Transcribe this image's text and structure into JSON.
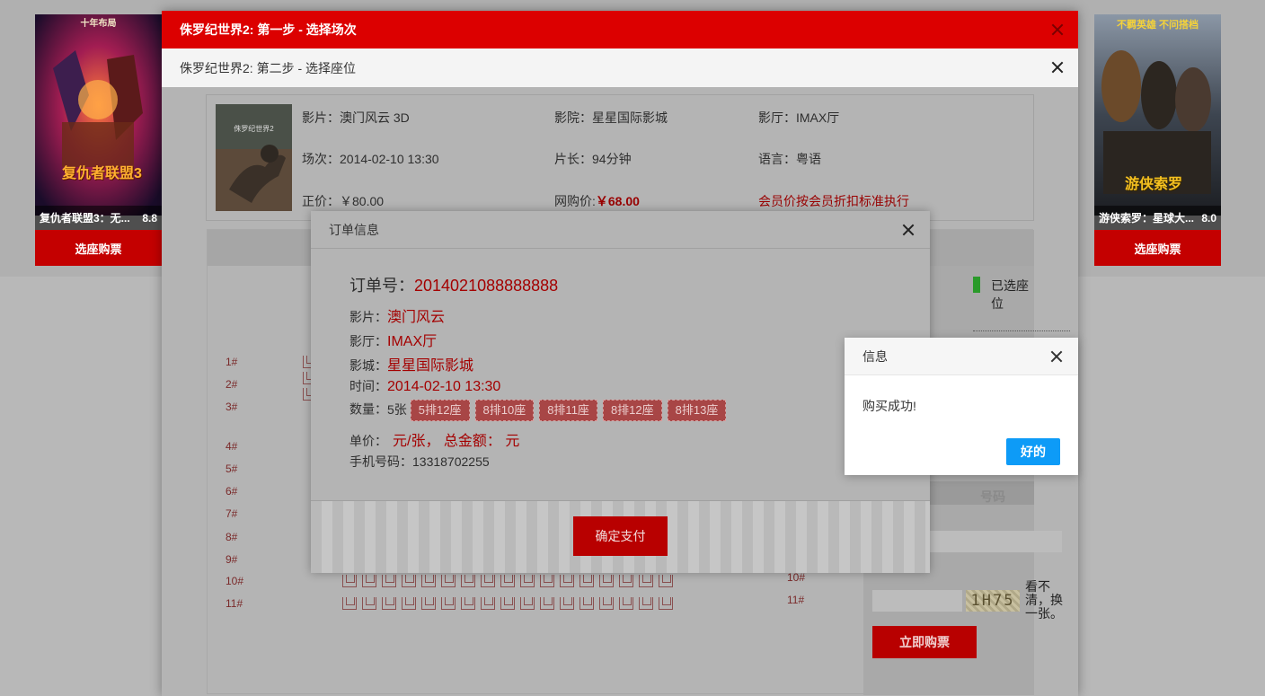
{
  "posters": {
    "left": {
      "title": "复仇者联盟3：无...",
      "rating": "8.8",
      "button": "选座购票",
      "art_text": "复仇者联盟3",
      "top_banner": "十年布局"
    },
    "right": {
      "title": "游侠索罗：星球大...",
      "rating": "8.0",
      "button": "选座购票",
      "art_text": "游侠索罗",
      "top_banner": "不羁英雄  不问搭档"
    }
  },
  "window": {
    "step1_title": "侏罗纪世界2: 第一步 - 选择场次",
    "step2_title": "侏罗纪世界2: 第二步 - 选择座位"
  },
  "movie_info": {
    "film_label": "影片：",
    "film": "澳门风云 3D",
    "cinema_label": "影院：",
    "cinema": "星星国际影城",
    "hall_label": "影厅：",
    "hall": "IMAX厅",
    "session_label": "场次：",
    "session": "2014-02-10 13:30",
    "length_label": "片长：",
    "length": "94分钟",
    "lang_label": "语言：",
    "lang": "粤语",
    "price_label": "正价：",
    "price": "￥80.00",
    "online_label": "网购价:",
    "online": "￥68.00",
    "member_note": "会员价按会员折扣标准执行",
    "poster_text": "侏罗纪世界2"
  },
  "seat_map": {
    "legend_selected": "已选座位",
    "rows_left": [
      "1#",
      "2#",
      "3#",
      "4#",
      "5#",
      "6#",
      "7#",
      "8#",
      "9#",
      "10#",
      "11#"
    ],
    "rows_right": [
      "10#",
      "11#"
    ],
    "phone_label_partial": "号码",
    "captcha": "1H75",
    "captcha_refresh": "看不清，换一张。",
    "buy_button": "立即购票"
  },
  "order_modal": {
    "title": "订单信息",
    "order_no_label": "订单号：",
    "order_no": "2014021088888888",
    "film_label": "影片：",
    "film": "澳门风云",
    "hall_label": "影厅：",
    "hall": "IMAX厅",
    "cinema_label": "影城：",
    "cinema": "星星国际影城",
    "time_label": "时间：",
    "time": "2014-02-10 13:30",
    "qty_label": "数量：",
    "qty": "5张",
    "seats": [
      "5排12座",
      "8排10座",
      "8排11座",
      "8排12座",
      "8排13座"
    ],
    "unit_label": "单价：",
    "unit_text": "元/张， 总金额：  元",
    "phone_label": "手机号码：",
    "phone": "13318702255",
    "pay_button": "确定支付"
  },
  "info_dialog": {
    "title": "信息",
    "message": "购买成功!",
    "ok_button": "好的"
  },
  "colors": {
    "primary_red": "#dc0000",
    "ok_blue": "#0d9bf7"
  }
}
